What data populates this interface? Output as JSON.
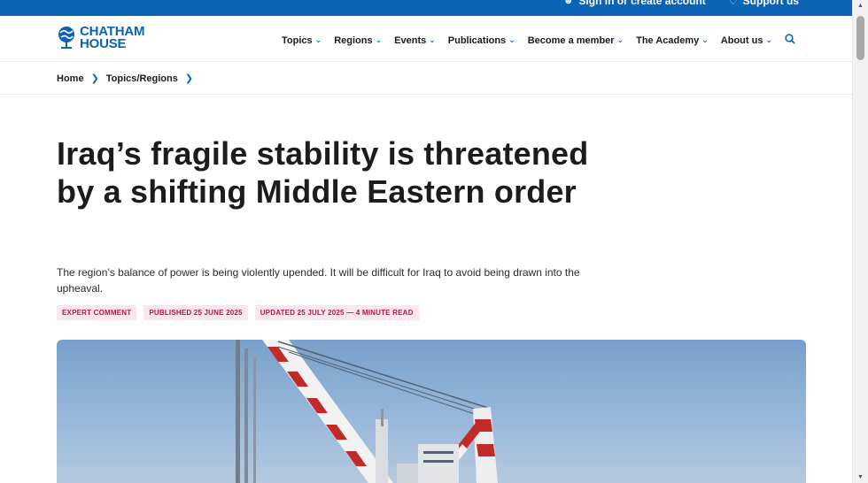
{
  "topbar": {
    "sign_in": "Sign in or create account",
    "support": "Support us"
  },
  "logo": {
    "line1": "CHATHAM",
    "line2": "HOUSE"
  },
  "nav": {
    "items": [
      "Topics",
      "Regions",
      "Events",
      "Publications",
      "Become a member",
      "The Academy",
      "About us"
    ]
  },
  "breadcrumb": {
    "home": "Home",
    "section": "Topics/Regions"
  },
  "article": {
    "title": "Iraq’s fragile stability is threatened by a shifting Middle Eastern order",
    "lede": "The region’s balance of power is being violently upended. It will be difficult for Iraq to avoid being drawn into the upheaval.",
    "tags": [
      "EXPERT COMMENT",
      "PUBLISHED 25 JUNE 2025",
      "UPDATED 25 JULY 2025 — 4 MINUTE READ"
    ]
  },
  "colors": {
    "brand_blue": "#0b63b6",
    "tag_bg": "#fbe6f0",
    "tag_text": "#b0154f"
  },
  "icons": [
    "user-icon",
    "heart-icon",
    "chevron-down-icon",
    "search-icon",
    "chevron-right-icon"
  ]
}
